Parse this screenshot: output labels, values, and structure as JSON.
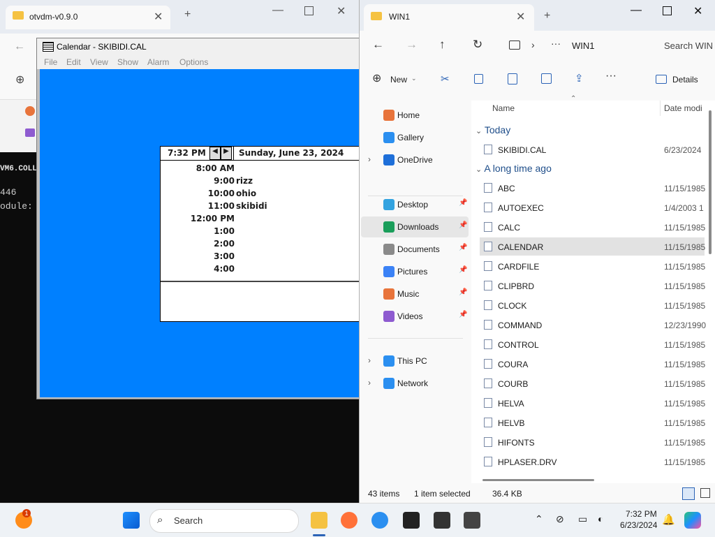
{
  "left_explorer": {
    "tab_title": "otvdm-v0.9.0",
    "new_tab_glyph": "+"
  },
  "console": {
    "line1": "VM6.COLL",
    "line2": "446",
    "line3": "odule:"
  },
  "calendar_window": {
    "title": "Calendar - SKIBIDI.CAL",
    "menu": [
      "File",
      "Edit",
      "View",
      "Show",
      "Alarm",
      "Options"
    ],
    "current_time": "7:32 PM",
    "date": "Sunday, June 23, 2024",
    "rows": [
      {
        "time": "8:00 AM",
        "event": ""
      },
      {
        "time": "9:00",
        "event": "rizz"
      },
      {
        "time": "10:00",
        "event": "ohio"
      },
      {
        "time": "11:00",
        "event": "skibidi"
      },
      {
        "time": "12:00 PM",
        "event": ""
      },
      {
        "time": "1:00",
        "event": ""
      },
      {
        "time": "2:00",
        "event": ""
      },
      {
        "time": "3:00",
        "event": ""
      },
      {
        "time": "4:00",
        "event": ""
      }
    ]
  },
  "explorer": {
    "tab_title": "WIN1",
    "address": "WIN1",
    "search_placeholder": "Search WIN",
    "new_label": "New",
    "details_label": "Details",
    "columns": {
      "name": "Name",
      "date": "Date modi"
    },
    "sidebar": {
      "top": [
        {
          "label": "Home",
          "icon": "home-icon"
        },
        {
          "label": "Gallery",
          "icon": "gallery-icon"
        },
        {
          "label": "OneDrive",
          "icon": "onedrive-icon"
        }
      ],
      "pinned": [
        {
          "label": "Desktop",
          "icon": "desktop-icon"
        },
        {
          "label": "Downloads",
          "icon": "downloads-icon"
        },
        {
          "label": "Documents",
          "icon": "documents-icon"
        },
        {
          "label": "Pictures",
          "icon": "pictures-icon"
        },
        {
          "label": "Music",
          "icon": "music-icon"
        },
        {
          "label": "Videos",
          "icon": "videos-icon"
        }
      ],
      "bottom": [
        {
          "label": "This PC",
          "icon": "computer-icon"
        },
        {
          "label": "Network",
          "icon": "network-icon"
        }
      ]
    },
    "groups": {
      "today": "Today",
      "long_ago": "A long time ago"
    },
    "today_files": [
      {
        "name": "SKIBIDI.CAL",
        "date": "6/23/2024"
      }
    ],
    "old_files": [
      {
        "name": "ABC",
        "date": "11/15/1985"
      },
      {
        "name": "AUTOEXEC",
        "date": "1/4/2003 1"
      },
      {
        "name": "CALC",
        "date": "11/15/1985"
      },
      {
        "name": "CALENDAR",
        "date": "11/15/1985"
      },
      {
        "name": "CARDFILE",
        "date": "11/15/1985"
      },
      {
        "name": "CLIPBRD",
        "date": "11/15/1985"
      },
      {
        "name": "CLOCK",
        "date": "11/15/1985"
      },
      {
        "name": "COMMAND",
        "date": "12/23/1990"
      },
      {
        "name": "CONTROL",
        "date": "11/15/1985"
      },
      {
        "name": "COURA",
        "date": "11/15/1985"
      },
      {
        "name": "COURB",
        "date": "11/15/1985"
      },
      {
        "name": "HELVA",
        "date": "11/15/1985"
      },
      {
        "name": "HELVB",
        "date": "11/15/1985"
      },
      {
        "name": "HIFONTS",
        "date": "11/15/1985"
      },
      {
        "name": "HPLASER.DRV",
        "date": "11/15/1985"
      }
    ],
    "status": {
      "count": "43 items",
      "selected": "1 item selected",
      "size": "36.4 KB"
    }
  },
  "taskbar": {
    "search_label": "Search",
    "time": "7:32 PM",
    "date": "6/23/2024",
    "notification_badge": "1"
  }
}
